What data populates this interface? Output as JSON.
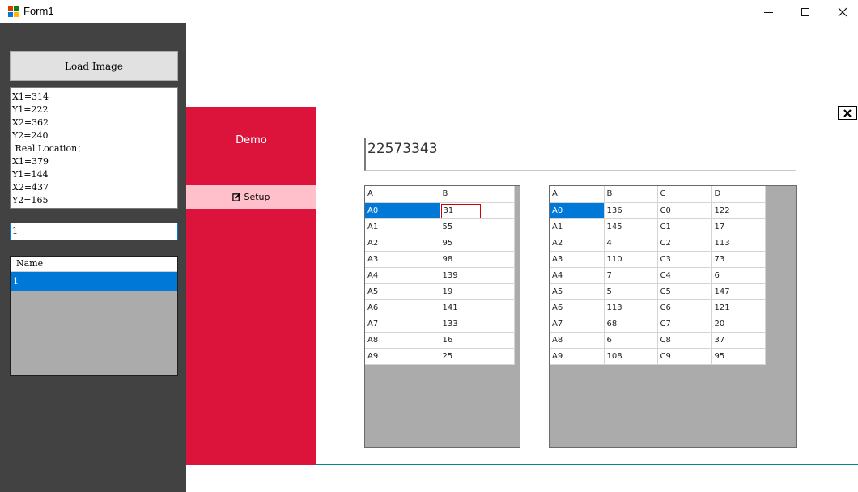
{
  "window": {
    "title": "Form1",
    "icon": "winforms-app-icon",
    "controls": [
      "minimize-icon",
      "maximize-icon",
      "close-icon"
    ]
  },
  "sidebar": {
    "load_button_label": "Load Image",
    "coordinates": [
      "X1=314",
      "Y1=222",
      "X2=362",
      "Y2=240",
      " Real Location：",
      "X1=379",
      "Y1=144",
      "X2=437",
      "Y2=165"
    ],
    "name_input_value": "1",
    "list": {
      "header": "Name",
      "items": [
        "1"
      ]
    }
  },
  "menu": {
    "title": "Demo",
    "setup_label": "Setup",
    "setup_icon": "edit-icon"
  },
  "close_panel_icon": "close-x-icon",
  "value_text": "22573343",
  "grid1": {
    "columns": [
      "A",
      "B"
    ],
    "rows": [
      [
        "A0",
        "31"
      ],
      [
        "A1",
        "55"
      ],
      [
        "A2",
        "95"
      ],
      [
        "A3",
        "98"
      ],
      [
        "A4",
        "139"
      ],
      [
        "A5",
        "19"
      ],
      [
        "A6",
        "141"
      ],
      [
        "A7",
        "133"
      ],
      [
        "A8",
        "16"
      ],
      [
        "A9",
        "25"
      ]
    ]
  },
  "grid2": {
    "columns": [
      "A",
      "B",
      "C",
      "D"
    ],
    "rows": [
      [
        "A0",
        "136",
        "C0",
        "122"
      ],
      [
        "A1",
        "145",
        "C1",
        "17"
      ],
      [
        "A2",
        "4",
        "C2",
        "113"
      ],
      [
        "A3",
        "110",
        "C3",
        "73"
      ],
      [
        "A4",
        "7",
        "C4",
        "6"
      ],
      [
        "A5",
        "5",
        "C5",
        "147"
      ],
      [
        "A6",
        "113",
        "C6",
        "121"
      ],
      [
        "A7",
        "68",
        "C7",
        "20"
      ],
      [
        "A8",
        "6",
        "C8",
        "37"
      ],
      [
        "A9",
        "108",
        "C9",
        "95"
      ]
    ]
  },
  "colors": {
    "sidebar_bg": "#424242",
    "menu_bg": "#dc143c",
    "menu_selected_bg": "#ffc0cb",
    "selection": "#0078d7",
    "grid_bg": "#ababab",
    "edit_border": "#d10000"
  }
}
